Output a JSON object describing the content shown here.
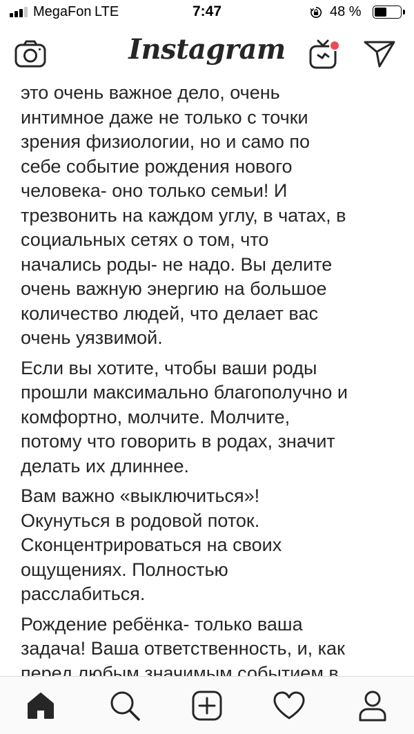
{
  "status_bar": {
    "carrier": "MegaFon",
    "network": "LTE",
    "time": "7:47",
    "battery_percent": "48 %",
    "battery_level": 0.48,
    "signal_bars_active": 3,
    "signal_bars_total": 4
  },
  "header": {
    "app_title": "Instagram",
    "icons": [
      "camera-icon",
      "igtv-icon",
      "direct-send-icon"
    ],
    "notification_dot_color": "#ed4956"
  },
  "caption": {
    "paragraphs": [
      "это очень важное дело, очень\nинтимное даже не только с точки\nзрения физиологии, но и само по\nсебе событие рождения нового\nчеловека- оно только семьи! И\nтрезвонить на каждом углу, в чатах, в\nсоциальных сетях о том, что\nначались роды- не надо. Вы делите\nочень важную энергию на большое\nколичество людей, что делает вас\nочень уязвимой.",
      "Если вы хотите, чтобы ваши роды\nпрошли максимально благополучно и\nкомфортно, молчите. Молчите,\nпотому что говорить в родах, значит\nделать их длиннее.",
      "Вам важно «выключиться»!\nОкунуться в родовой поток.\nСконцентрироваться на своих\nощущениях. Полностью\nрасслабиться.",
      "Рождение ребёнка- только ваша\nзадача! Ваша ответственность, и, как\nперед любым значимым событием в"
    ]
  },
  "tab_bar": {
    "tabs": [
      {
        "name": "home",
        "icon": "home-icon",
        "active": true
      },
      {
        "name": "search",
        "icon": "search-icon",
        "active": false
      },
      {
        "name": "new-post",
        "icon": "plus-square-icon",
        "active": false
      },
      {
        "name": "activity",
        "icon": "heart-icon",
        "active": false
      },
      {
        "name": "profile",
        "icon": "profile-icon",
        "active": false
      }
    ]
  }
}
